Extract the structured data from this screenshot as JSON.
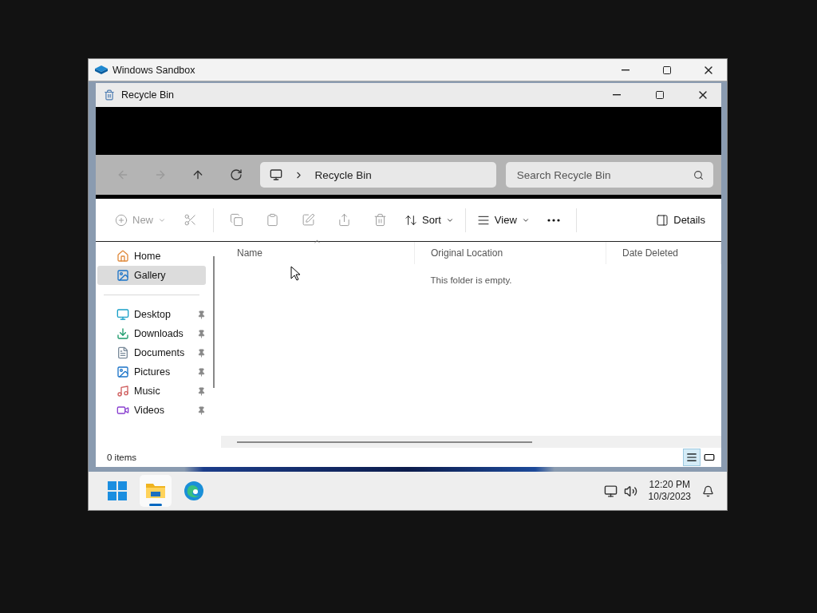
{
  "sandbox": {
    "title": "Windows Sandbox"
  },
  "explorer": {
    "title": "Recycle Bin",
    "nav": [
      {
        "disabled": true
      },
      {
        "disabled": true
      },
      {
        "disabled": false
      },
      {
        "disabled": false
      }
    ],
    "breadcrumb": [
      "Recycle Bin"
    ],
    "search": {
      "placeholder": "Search Recycle Bin"
    },
    "commands": [
      {
        "kind": "menu",
        "label": "New",
        "disabled": true
      },
      {
        "kind": "icon",
        "disabled": true
      },
      {
        "kind": "icon",
        "disabled": true
      },
      {
        "kind": "icon",
        "disabled": true
      },
      {
        "kind": "icon",
        "disabled": true
      },
      {
        "kind": "icon",
        "disabled": true
      },
      {
        "kind": "icon",
        "disabled": true
      },
      {
        "kind": "menu",
        "label": "Sort",
        "disabled": false
      },
      {
        "kind": "menu",
        "label": "View",
        "disabled": false
      },
      {
        "kind": "icon",
        "disabled": false
      },
      {
        "kind": "toggle",
        "label": "Details",
        "disabled": false
      }
    ],
    "sidebar": {
      "groups": [
        {
          "items": [
            {
              "label": "Home",
              "selected": false,
              "pinned": false
            },
            {
              "label": "Gallery",
              "selected": true,
              "pinned": false
            }
          ]
        },
        {
          "items": [
            {
              "label": "Desktop",
              "selected": false,
              "pinned": true
            },
            {
              "label": "Downloads",
              "selected": false,
              "pinned": true
            },
            {
              "label": "Documents",
              "selected": false,
              "pinned": true
            },
            {
              "label": "Pictures",
              "selected": false,
              "pinned": true
            },
            {
              "label": "Music",
              "selected": false,
              "pinned": true
            },
            {
              "label": "Videos",
              "selected": false,
              "pinned": true
            }
          ]
        }
      ]
    },
    "columns": [
      {
        "label": "Name",
        "sorted": true
      },
      {
        "label": "Original Location",
        "sorted": false
      },
      {
        "label": "Date Deleted",
        "sorted": false
      }
    ],
    "empty_message": "This folder is empty.",
    "status_bar": {
      "count": "0 items",
      "views": [
        {
          "selected": true
        },
        {
          "selected": false
        }
      ]
    }
  },
  "taskbar": {
    "apps": [
      {
        "selected": false
      },
      {
        "selected": true
      },
      {
        "selected": false
      }
    ],
    "time": "12:20 PM",
    "date": "10/3/2023"
  }
}
